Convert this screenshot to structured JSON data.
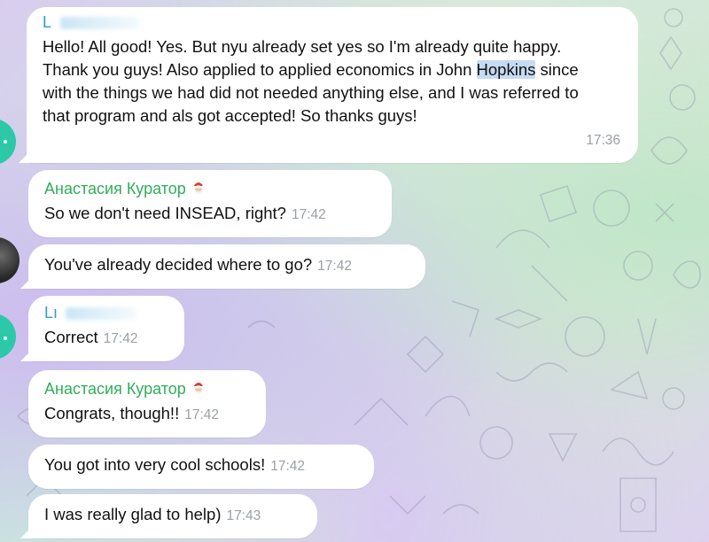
{
  "chat": {
    "messages": [
      {
        "sender": "L",
        "text_before_highlight": "Hello! All good! Yes. But nyu already set yes so I'm already quite happy. Thank you guys! Also applied to applied economics in John ",
        "highlight": "Hopkins",
        "text_after_highlight": " since with the things we had did not needed anything else, and I was referred to that program and als got accepted! So thanks guys!",
        "time": "17:36"
      },
      {
        "sender": "Анастасия Куратор",
        "text": "So we don't need INSEAD, right?",
        "time": "17:42"
      },
      {
        "text": "You've already decided where to go?",
        "time": "17:42"
      },
      {
        "sender": "Lı",
        "text": "Correct",
        "time": "17:42"
      },
      {
        "sender": "Анастасия Куратор",
        "text": "Congrats, though!!",
        "time": "17:42"
      },
      {
        "text": "You got into very cool schools!",
        "time": "17:42"
      },
      {
        "text": "I was really glad to help)",
        "time": "17:43"
      }
    ]
  },
  "colors": {
    "sender_green": "#2fae5a",
    "sender_blue": "#2f9bd6",
    "avatar_teal": "#2cc9a8",
    "timestamp": "#9aa0a6"
  },
  "icons": [
    "santa-emoji-icon",
    "teal-avatar-icon",
    "photo-avatar-icon"
  ]
}
